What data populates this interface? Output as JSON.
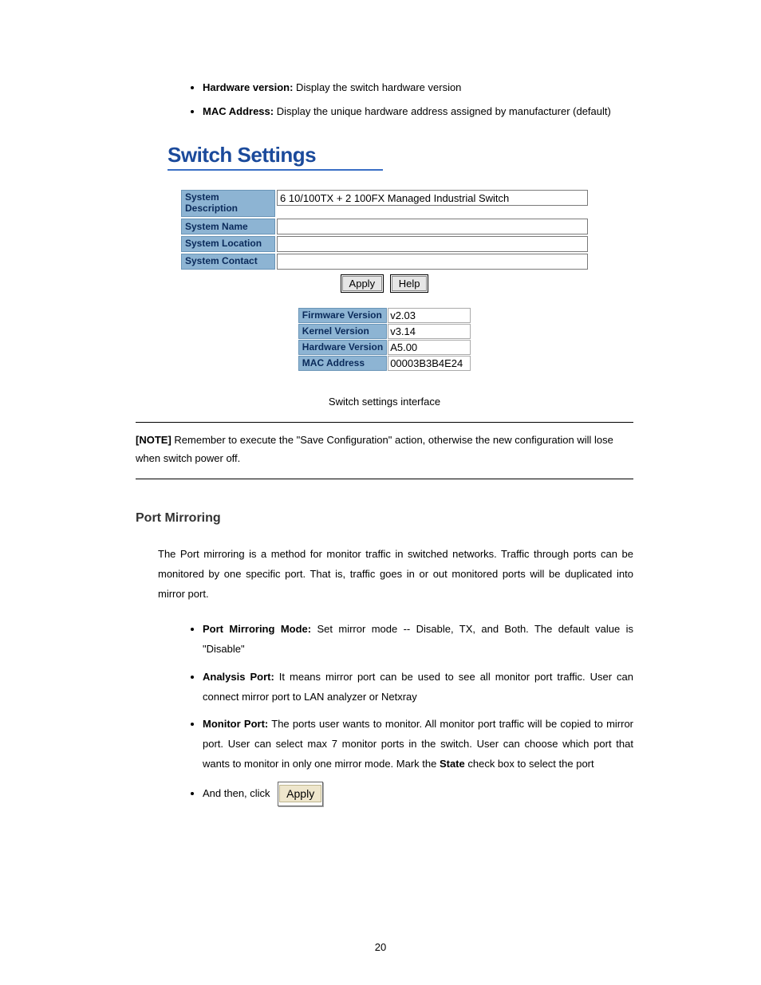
{
  "top_bullets": [
    {
      "label": "Hardware version:",
      "text": " Display the switch hardware version"
    },
    {
      "label": "MAC Address:",
      "text": " Display the unique hardware address assigned by manufacturer (default)"
    }
  ],
  "panel": {
    "title": "Switch Settings",
    "fields": {
      "system_description": {
        "label": "System Description",
        "value": "6 10/100TX + 2 100FX Managed Industrial Switch"
      },
      "system_name": {
        "label": "System Name",
        "value": ""
      },
      "system_location": {
        "label": "System Location",
        "value": ""
      },
      "system_contact": {
        "label": "System Contact",
        "value": ""
      }
    },
    "buttons": {
      "apply": "Apply",
      "help": "Help"
    },
    "versions": {
      "firmware": {
        "label": "Firmware Version",
        "value": "v2.03"
      },
      "kernel": {
        "label": "Kernel Version",
        "value": "v3.14"
      },
      "hardware": {
        "label": "Hardware Version",
        "value": "A5.00"
      },
      "mac": {
        "label": "MAC Address",
        "value": "00003B3B4E24"
      }
    },
    "caption": "Switch settings interface"
  },
  "note": {
    "label": "[NOTE]",
    "text": " Remember to execute the \"Save Configuration\" action, otherwise the new configuration will lose when switch power off."
  },
  "section": {
    "heading": "Port Mirroring",
    "intro": "The Port mirroring is a method for monitor traffic in switched networks. Traffic through ports can be monitored by one specific port. That is, traffic goes in or out monitored ports will be duplicated into mirror port.",
    "bullets": [
      {
        "label": "Port Mirroring Mode:",
        "text": " Set mirror mode -- Disable, TX, and Both. The default value is \"Disable\""
      },
      {
        "label": "Analysis Port:",
        "text": " It means mirror port can be used to see all monitor port traffic. User can connect mirror port to LAN analyzer or Netxray"
      },
      {
        "label": "Monitor Port:",
        "text_before": " The ports user wants to monitor. All monitor port traffic will be copied to mirror port. User can select max 7 monitor ports in the switch. User can choose which port that wants to monitor in only one mirror mode. Mark the ",
        "state_word": "State",
        "text_after": " check box to select the port"
      }
    ],
    "last_bullet_prefix": "And then, click",
    "inline_apply": "Apply"
  },
  "page_number": "20"
}
